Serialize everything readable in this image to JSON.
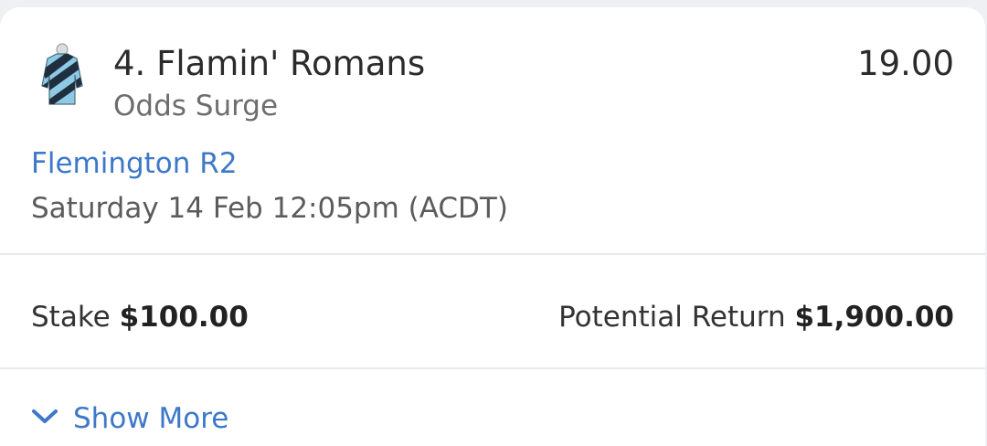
{
  "runner": {
    "name": "4. Flamin' Romans",
    "bet_type": "Odds Surge",
    "odds": "19.00",
    "silk_icon": "jockey-silk-icon",
    "silk_colors": {
      "primary": "#8ecae6",
      "stripe": "#1f2f3f"
    }
  },
  "race": {
    "link": "Flemington R2",
    "time": "Saturday 14 Feb 12:05pm (ACDT)"
  },
  "bet": {
    "stake_label": "Stake",
    "stake_value": "$100.00",
    "return_label": "Potential Return",
    "return_value": "$1,900.00"
  },
  "footer": {
    "show_more_label": "Show More",
    "chevron_icon": "chevron-down-icon"
  },
  "colors": {
    "link": "#3d78c9",
    "muted": "#6d6d6d",
    "divider": "#e6e8eb"
  }
}
